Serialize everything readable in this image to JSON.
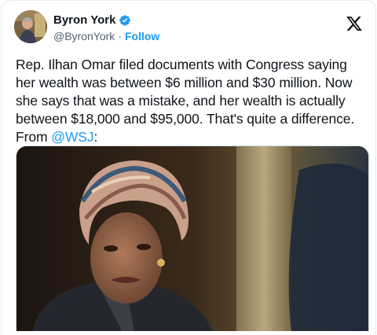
{
  "author": {
    "name": "Byron York",
    "handle": "@ByronYork",
    "separator": "·",
    "follow_label": "Follow",
    "verified_color": "#1d9bf0"
  },
  "tweet": {
    "text_before": "Rep. Ilhan Omar filed documents with Congress saying her wealth was between $6 million and $30 million. Now she says that was a mistake, and her wealth is actually between $18,000 and $95,000. That's quite a difference. From ",
    "mention": "@WSJ",
    "text_after": ":"
  },
  "icons": {
    "avatar": "author-avatar",
    "verified": "verified-badge-icon",
    "platform": "x-logo-icon"
  },
  "media": {
    "type": "photo"
  },
  "colors": {
    "accent": "#1d9bf0",
    "text": "#0f1419",
    "muted": "#536471"
  }
}
